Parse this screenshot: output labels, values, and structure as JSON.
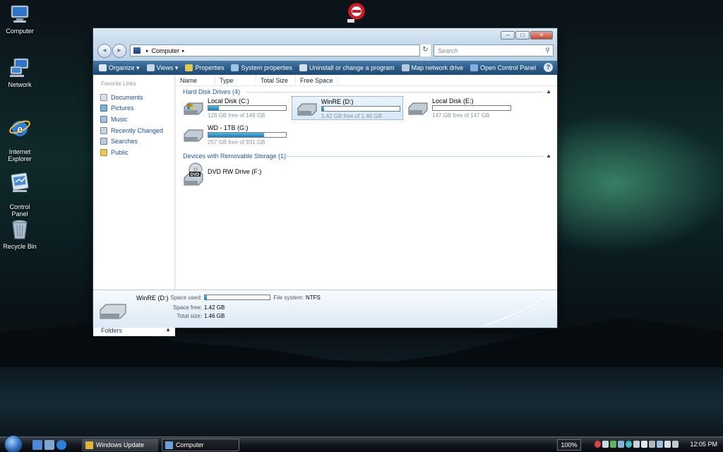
{
  "desktop": {
    "icons": [
      {
        "label": "Computer"
      },
      {
        "label": "Network"
      },
      {
        "label": "Internet\nExplorer"
      },
      {
        "label": "Control\nPanel"
      },
      {
        "label": "Recycle Bin"
      }
    ]
  },
  "window": {
    "buttons": {
      "minimize": "–",
      "maximize": "□",
      "close": "✕"
    },
    "address": {
      "crumb": "Computer",
      "separator": "▸"
    },
    "search": {
      "placeholder": "Search"
    },
    "toolbar": {
      "organize": "Organize",
      "views": "Views",
      "properties": "Properties",
      "system_properties": "System properties",
      "uninstall": "Uninstall or change a program",
      "map_drive": "Map network drive",
      "control_panel": "Open Control Panel",
      "help": "?"
    },
    "sidebar": {
      "title": "Favorite Links",
      "items": [
        {
          "label": "Documents"
        },
        {
          "label": "Pictures"
        },
        {
          "label": "Music"
        },
        {
          "label": "Recently Changed"
        },
        {
          "label": "Searches"
        },
        {
          "label": "Public"
        }
      ],
      "folders": "Folders"
    },
    "columns": [
      "Name",
      "Type",
      "Total Size",
      "Free Space"
    ],
    "groups": {
      "hard_disks": "Hard Disk Drives (4)",
      "removable": "Devices with Removable Storage (1)"
    },
    "drives": [
      {
        "name": "Local Disk (C:)",
        "free": "128 GB free of 149 GB",
        "used_fraction": 0.14
      },
      {
        "name": "WinRE (D:)",
        "free": "1.42 GB free of 1.46 GB",
        "used_fraction": 0.03
      },
      {
        "name": "Local Disk (E:)",
        "free": "147 GB free of 147 GB",
        "used_fraction": 0.0
      },
      {
        "name": "WD - 1TB (G:)",
        "free": "257 GB free of 931 GB",
        "used_fraction": 0.72
      }
    ],
    "removable": [
      {
        "name": "DVD RW Drive (F:)",
        "badge": "DVD"
      }
    ],
    "details": {
      "name": "WinRE (D:)",
      "space_used_label": "Space used:",
      "used_fraction": 0.03,
      "filesystem_label": "File system:",
      "filesystem": "NTFS",
      "space_free_label": "Space free:",
      "space_free": "1.42 GB",
      "total_size_label": "Total size:",
      "total_size": "1.46 GB"
    }
  },
  "taskbar": {
    "tasks": [
      {
        "label": "Windows Update"
      },
      {
        "label": "Computer"
      }
    ],
    "zoom": "100%",
    "clock": "12:05 PM"
  }
}
